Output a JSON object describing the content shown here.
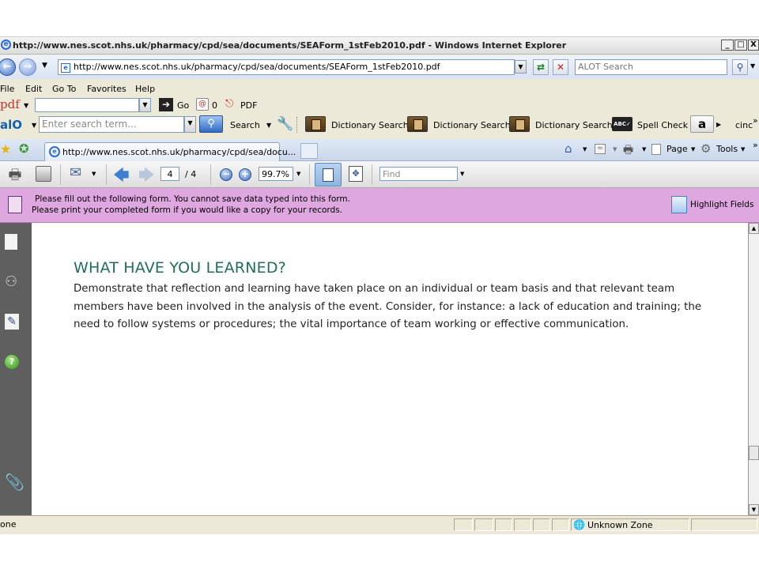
{
  "window": {
    "title": "http://www.nes.scot.nhs.uk/pharmacy/cpd/sea/documents/SEAForm_1stFeb2010.pdf - Windows Internet Explorer",
    "min": "_",
    "max": "□",
    "close": "X"
  },
  "address": {
    "url": "http://www.nes.scot.nhs.uk/pharmacy/cpd/sea/documents/SEAForm_1stFeb2010.pdf",
    "search_placeholder": "ALOT Search"
  },
  "menu": [
    "File",
    "Edit",
    "Go To",
    "Favorites",
    "Help"
  ],
  "pdf_toolbar": {
    "brand": "pdf",
    "go_label": "Go",
    "count": "0",
    "pdf_label": "PDF"
  },
  "alot_toolbar": {
    "brand": "alO",
    "search_placeholder": "Enter search term...",
    "search_label": "Search",
    "buttons": [
      "Dictionary Search",
      "Dictionary Search",
      "Dictionary Search",
      "Spell Check"
    ],
    "amazon": "a",
    "overflow": "cinc"
  },
  "tab": {
    "title": "http://www.nes.scot.nhs.uk/pharmacy/cpd/sea/docu..."
  },
  "command_bar": {
    "page_label": "Page",
    "tools_label": "Tools"
  },
  "reader": {
    "current_page": "4",
    "total_pages": "/ 4",
    "zoom": "99.7%",
    "find_placeholder": "Find"
  },
  "message_bar": {
    "line1": "Please fill out the following form. You cannot save data typed into this form.",
    "line2": "Please print your completed form if you would like a copy for your records.",
    "highlight_label": "Highlight Fields"
  },
  "document": {
    "heading": "WHAT HAVE YOU LEARNED?",
    "paragraph": "Demonstrate that reflection and learning have taken place on an individual or team basis and that relevant team members have been involved in the analysis of the event. Consider, for instance: a lack of education and training; the need to follow systems or procedures; the vital importance of team working or effective communication."
  },
  "status_bar": {
    "left_text": "one",
    "zone": "Unknown Zone"
  },
  "colors": {
    "message_bar": "#dfa7df",
    "heading": "#1f6e5a",
    "sidebar": "#5f5f5f"
  }
}
